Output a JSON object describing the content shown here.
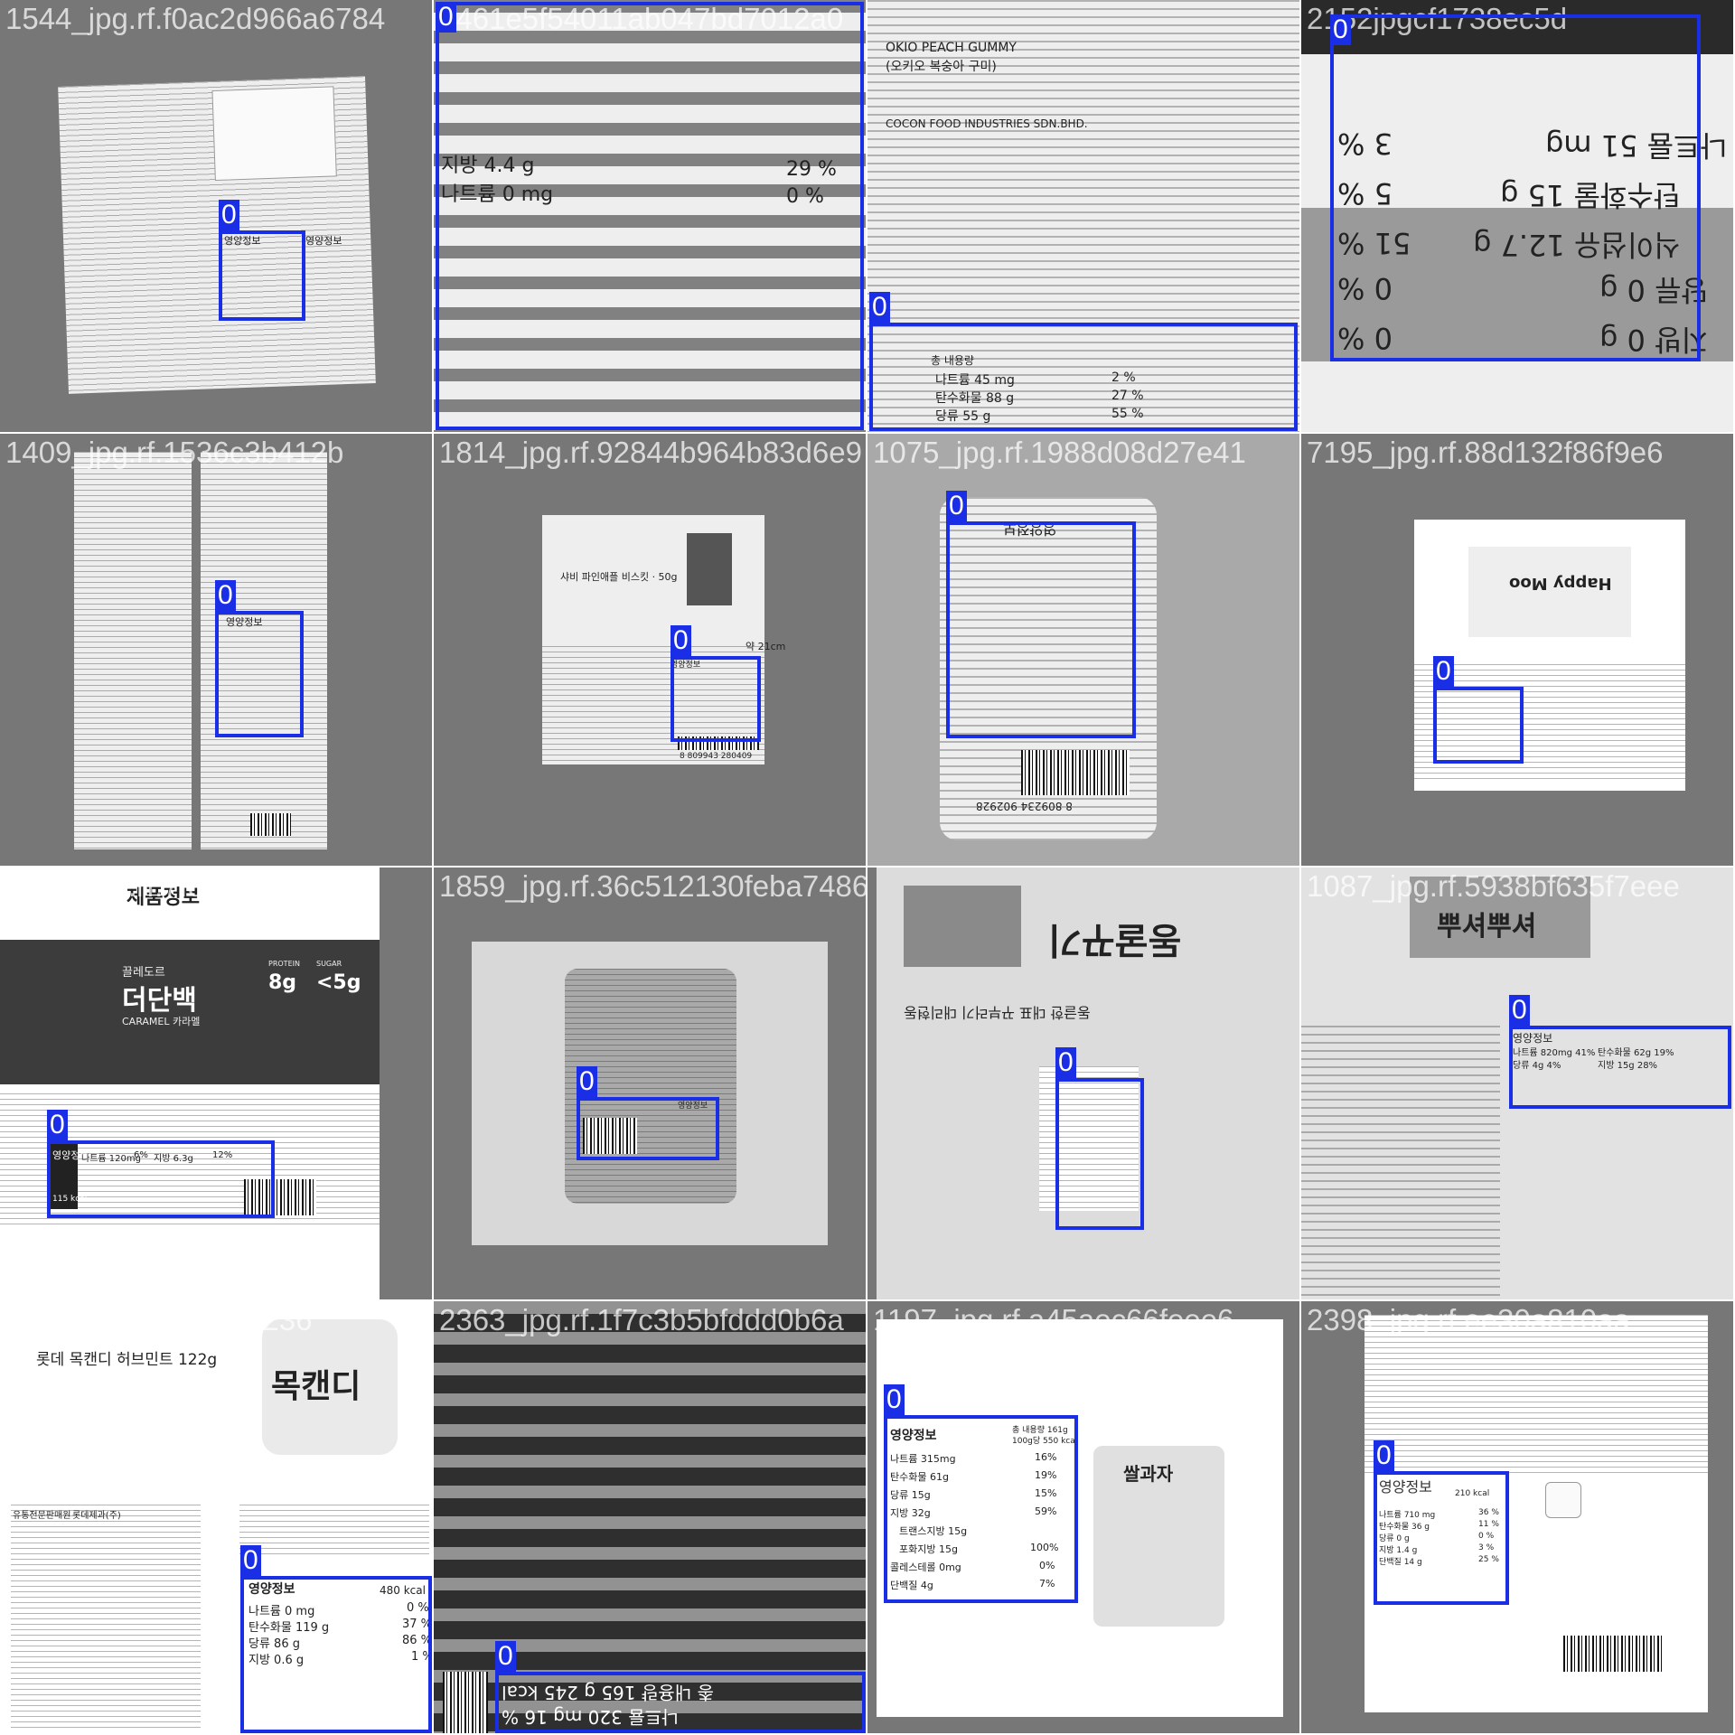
{
  "colors": {
    "box": "#1a2ee6",
    "caption": "#ffffff",
    "tile_background": "#777777"
  },
  "tiles": [
    {
      "caption": "1544_jpg.rf.f0ac2d966a6784",
      "boxes": [
        {
          "label": "0"
        }
      ],
      "text": [
        "영양정보",
        "영양정보"
      ]
    },
    {
      "caption": "2461e5f54011ab047bd7012a0",
      "boxes": [
        {
          "label": "0"
        }
      ],
      "text": [
        "지방 4.4 g",
        "29 %",
        "나트륨 0 mg",
        "0 %"
      ]
    },
    {
      "caption": "",
      "boxes": [
        {
          "label": "0"
        }
      ],
      "text": [
        "OKIO PEACH GUMMY",
        "(오키오 복숭아 구미)",
        "COCON FOOD INDUSTRIES SDN.BHD.",
        "총 내용량",
        "나트륨 45 mg",
        "2 %",
        "탄수화물 88 g",
        "27 %",
        "당류 55 g",
        "55 %"
      ]
    },
    {
      "caption": "2152jpgcf1738ec5d",
      "boxes": [
        {
          "label": "0"
        }
      ],
      "text": [
        "나트륨 51 mg",
        "3 %",
        "탄수화물 15 g",
        "5 %",
        "식이섬유 12.7 g",
        "51 %",
        "당류 0 g",
        "0 %",
        "지방 0 g",
        "0 %"
      ]
    },
    {
      "caption": "1409_jpg.rf.1536c3b412b",
      "boxes": [
        {
          "label": "0"
        }
      ],
      "text": [
        "영양정보"
      ]
    },
    {
      "caption": "1814_jpg.rf.92844b964b83d6e9",
      "boxes": [
        {
          "label": "0"
        }
      ],
      "text": [
        "샤비 파인애플 비스킷 · 50g",
        "약 21cm",
        "영양정보",
        "8 809943 280409"
      ]
    },
    {
      "caption": "1075_jpg.rf.1988d08d27e41",
      "boxes": [
        {
          "label": "0"
        }
      ],
      "text": [
        "영양정보",
        "8 809234 902928"
      ]
    },
    {
      "caption": "7195_jpg.rf.88d132f86f9e6",
      "boxes": [
        {
          "label": "0"
        }
      ],
      "text": [
        "Happy Moo"
      ]
    },
    {
      "caption": "1422_jpg.rf.7f8233f751377",
      "boxes": [
        {
          "label": "0"
        }
      ],
      "text": [
        "제품정보",
        "끌레도르",
        "더단백",
        "CARAMEL 카라멜",
        "8g",
        "<5g",
        "PROTEIN",
        "SUGAR",
        "영양정보",
        "나트륨 120mg",
        "6%",
        "지방 6.3g",
        "12%",
        "115 kcal"
      ]
    },
    {
      "caption": "1859_jpg.rf.36c512130feba7486",
      "boxes": [
        {
          "label": "0"
        }
      ],
      "text": [
        "영양정보"
      ]
    },
    {
      "caption": "",
      "boxes": [
        {
          "label": "0"
        }
      ],
      "text": [
        "동굴꾸기",
        "동글한 대표 꾸부러기 대리현동"
      ]
    },
    {
      "caption": "1087_jpg.rf.5938bf635f7eee",
      "boxes": [
        {
          "label": "0"
        }
      ],
      "text": [
        "뿌셔뿌셔",
        "영양정보",
        "나트륨 820mg 41%",
        "탄수화물 62g 19%",
        "당류 4g 4%",
        "지방 15g 28%"
      ]
    },
    {
      "caption": "1242_jpg.rf.815d2d236",
      "boxes": [
        {
          "label": "0"
        }
      ],
      "text": [
        "롯데 목캔디 허브민트 122g",
        "목캔디",
        "영양정보",
        "480 kcal",
        "나트륨 0 mg",
        "0 %",
        "탄수화물 119 g",
        "37 %",
        "당류 86 g",
        "86 %",
        "지방 0.6 g",
        "1 %",
        "유통전문판매원",
        "롯데제과(주)"
      ]
    },
    {
      "caption": "2363_jpg.rf.1f7c3b5bfddd0b6a",
      "boxes": [
        {
          "label": "0"
        }
      ],
      "text": [
        "총 내용량 165 g 245 kcal",
        "나트륨 320 mg 16 %"
      ]
    },
    {
      "caption": "1197_jpg.rf.a45aec66feee6",
      "boxes": [
        {
          "label": "0"
        }
      ],
      "text": [
        "영양정보",
        "총 내용량 161g",
        "100g당 550 kcal",
        "나트륨 315mg",
        "16%",
        "탄수화물 61g",
        "19%",
        "당류 15g",
        "15%",
        "지방 32g",
        "59%",
        "트랜스지방 15g",
        "포화지방 15g",
        "100%",
        "콜레스테롤 0mg",
        "0%",
        "단백질 4g",
        "7%",
        "쌀과자"
      ]
    },
    {
      "caption": "2398_jpg.rf.ee30a810aa",
      "boxes": [
        {
          "label": "0"
        }
      ],
      "text": [
        "영양정보",
        "210 kcal",
        "나트륨 710 mg",
        "36 %",
        "탄수화물 36 g",
        "11 %",
        "당류 0 g",
        "0 %",
        "지방 1.4 g",
        "3 %",
        "단백질 14 g",
        "25 %"
      ]
    }
  ]
}
